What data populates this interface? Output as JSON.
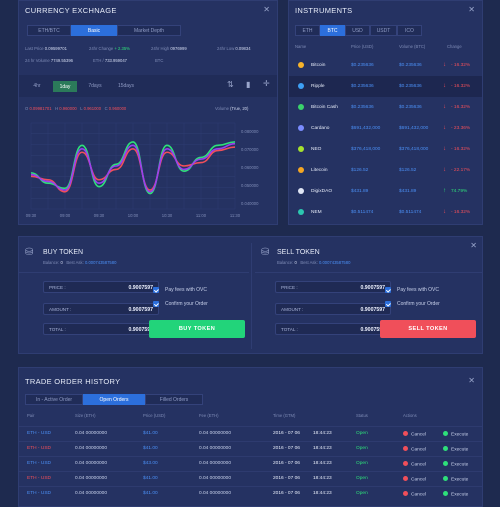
{
  "exchange": {
    "title": "CURRENCY EXCHNAGE",
    "tabs": [
      "ETH/BTC",
      "Basic",
      "Market Depth"
    ],
    "stats": [
      {
        "label": "Last Price",
        "value": "0.09599701"
      },
      {
        "label": "24hr Change",
        "value": "+ 2.35%"
      },
      {
        "label": "24hr High",
        "value": "0976999"
      },
      {
        "label": "24hr Low",
        "value": "0.09834"
      },
      {
        "label": "24 hr Volume",
        "value": "7749.55396"
      },
      {
        "label": "ETH /",
        "value": "733.959047"
      },
      {
        "label": "BTC",
        "value": ""
      }
    ],
    "ranges": [
      "4hr",
      "1day",
      "7days",
      "15days"
    ],
    "ohlc": {
      "o_label": "O",
      "o": "0.09981701",
      "h_label": "H",
      "h": "0.960000",
      "l_label": "L",
      "l": "0.961000",
      "c_label": "C",
      "c": "0.960000"
    },
    "volume_label": "Volume",
    "volume_value": "(True, 20)",
    "y_ticks": [
      "0.080000",
      "0.070000",
      "0.060000",
      "0.050000",
      "0.040000"
    ],
    "x_ticks": [
      "09:30",
      "09:00",
      "09:30",
      "10:00",
      "10:30",
      "11:00",
      "11:30"
    ]
  },
  "chart_data": {
    "type": "line",
    "x": [
      "09:30",
      "09:00",
      "09:30",
      "10:00",
      "10:30",
      "11:00",
      "11:30"
    ],
    "ylim": [
      0.035,
      0.085
    ],
    "series": [
      {
        "color": "#2ee07a",
        "values": [
          0.056,
          0.05,
          0.047,
          0.072,
          0.048,
          0.061,
          0.074,
          0.044,
          0.072,
          0.057,
          0.065,
          0.072,
          0.074
        ]
      },
      {
        "color": "#f04f5a",
        "values": [
          0.054,
          0.052,
          0.045,
          0.068,
          0.052,
          0.058,
          0.07,
          0.046,
          0.068,
          0.06,
          0.062,
          0.069,
          0.071
        ]
      },
      {
        "color": "#9a3ff0",
        "values": [
          0.055,
          0.051,
          0.046,
          0.07,
          0.05,
          0.06,
          0.072,
          0.045,
          0.07,
          0.058,
          0.064,
          0.07,
          0.073
        ]
      }
    ]
  },
  "instruments": {
    "title": "INSTRUMENTS",
    "tabs": [
      "ETH",
      "BTC",
      "USD",
      "USDT",
      "ICO"
    ],
    "headers": [
      "Name",
      "Price (USD)",
      "Volume (BTC)",
      "Change"
    ],
    "rows": [
      {
        "name": "Bitcoin",
        "price": "$0.235636",
        "volume": "$0.235636",
        "change": "- 16.32%",
        "up": false,
        "color": "#f7b32b"
      },
      {
        "name": "Ripple",
        "price": "$0.235636",
        "volume": "$0.235636",
        "change": "- 16.32%",
        "up": false,
        "color": "#3da0f5"
      },
      {
        "name": "Bitcoin Cash",
        "price": "$0.235636",
        "volume": "$0.235636",
        "change": "- 16.32%",
        "up": false,
        "color": "#3ad26b"
      },
      {
        "name": "Cardano",
        "price": "$691,432,000",
        "volume": "$691,432,000",
        "change": "- 23.36%",
        "up": false,
        "color": "#7b8cff"
      },
      {
        "name": "NEO",
        "price": "$376,418,000",
        "volume": "$376,418,000",
        "change": "- 16.32%",
        "up": false,
        "color": "#a6e22e"
      },
      {
        "name": "Litecoin",
        "price": "$126.52",
        "volume": "$126.52",
        "change": "- 22.17%",
        "up": false,
        "color": "#f5a623"
      },
      {
        "name": "DigixDAO",
        "price": "$431.89",
        "volume": "$431.89",
        "change": "74.79%",
        "up": true,
        "color": "#e0e6f5"
      },
      {
        "name": "NEM",
        "price": "$0.511474",
        "volume": "$0.511474",
        "change": "- 16.32%",
        "up": false,
        "color": "#2cc7b0"
      }
    ]
  },
  "buy": {
    "title": "BUY TOKEN",
    "balance_label": "Balance:",
    "balance": "0",
    "bestask_label": "Best Ask:",
    "bestask": "0.000743587580",
    "price_label": "PRICE :",
    "price": "0.9007597",
    "amount_label": "AMOUNT :",
    "amount": "0.9007597",
    "total_label": "TOTAL :",
    "total": "0.9007597",
    "opt1": "Pay fees with OVC",
    "opt2": "Confirm your Order",
    "button": "BUY TOKEN"
  },
  "sell": {
    "title": "SELL TOKEN",
    "balance_label": "Balance:",
    "balance": "0",
    "bestask_label": "Best Ask:",
    "bestask": "0.000743587580",
    "price_label": "PRICE :",
    "price": "0.9007597",
    "amount_label": "AMOUNT :",
    "amount": "0.9007597",
    "total_label": "TOTAL :",
    "total": "0.9007597",
    "opt1": "Pay fees with OVC",
    "opt2": "Confirm your Order",
    "button": "SELL TOKEN"
  },
  "history": {
    "title": "TRADE ORDER HISTORY",
    "tabs": [
      "In - Active Order",
      "Open Orders",
      "Filled Orders"
    ],
    "headers": [
      "Pair",
      "Size (ETH)",
      "Price (USD)",
      "Fee (ETH)",
      "Time (GTM)",
      "Status",
      "Actions"
    ],
    "rows": [
      {
        "pair": "ETH - USD",
        "size": "0.04 00000000",
        "price": "$41.00",
        "fee": "0.04 00000000",
        "date": "2016 - 07 06",
        "time": "18:44:23",
        "status": "Open",
        "cancel": "Cancel",
        "execute": "Execute",
        "pair_color": "#4b8ff5"
      },
      {
        "pair": "ETH - USD",
        "size": "0.04 00000000",
        "price": "$41.00",
        "fee": "0.04 00000000",
        "date": "2016 - 07 06",
        "time": "18:44:23",
        "status": "Open",
        "cancel": "Cancel",
        "execute": "Execute",
        "pair_color": "#f04f5a"
      },
      {
        "pair": "ETH - USD",
        "size": "0.04 00000000",
        "price": "$43.00",
        "fee": "0.04 00000000",
        "date": "2016 - 07 06",
        "time": "18:44:23",
        "status": "Open",
        "cancel": "Cancel",
        "execute": "Execute",
        "pair_color": "#4b8ff5"
      },
      {
        "pair": "ETH - USD",
        "size": "0.04 00000000",
        "price": "$41.00",
        "fee": "0.04 00000000",
        "date": "2016 - 07 06",
        "time": "18:44:23",
        "status": "Open",
        "cancel": "Cancel",
        "execute": "Execute",
        "pair_color": "#f04f5a"
      },
      {
        "pair": "ETH - USD",
        "size": "0.04 00000000",
        "price": "$41.00",
        "fee": "0.04 00000000",
        "date": "2016 - 07 06",
        "time": "18:44:23",
        "status": "Open",
        "cancel": "Cancel",
        "execute": "Execute",
        "pair_color": "#4b8ff5"
      }
    ]
  }
}
